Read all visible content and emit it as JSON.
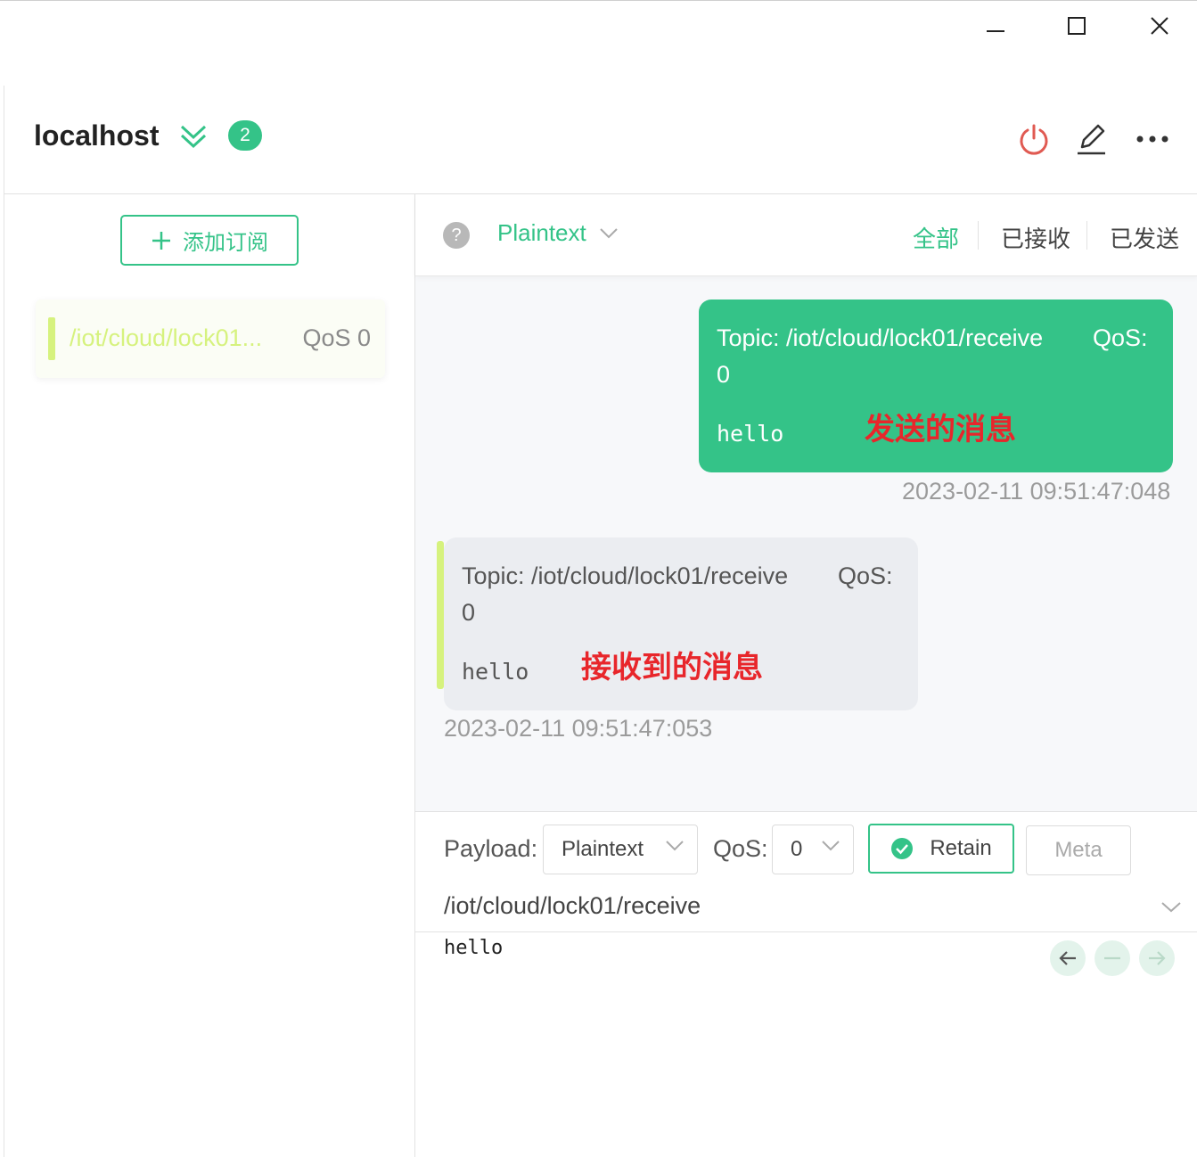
{
  "window": {
    "controls": [
      "minimize-icon",
      "maximize-icon",
      "close-icon"
    ]
  },
  "header": {
    "connection_name": "localhost",
    "badge_count": "2",
    "actions": [
      "power-icon",
      "edit-icon",
      "more-icon"
    ],
    "colors": {
      "accent": "#34c388",
      "disconnect": "#e05a52"
    }
  },
  "sidebar": {
    "add_subscription": "添加订阅",
    "subscriptions": [
      {
        "topic": "/iot/cloud/lock01...",
        "qos": "QoS 0",
        "color": "#d6f27e"
      }
    ]
  },
  "message_toolbar": {
    "format": "Plaintext",
    "filters": {
      "all": "全部",
      "received": "已接收",
      "sent": "已发送"
    },
    "active_filter": "all"
  },
  "messages": [
    {
      "direction": "sent",
      "topic_line1": "Topic: /iot/cloud/lock01/receive",
      "qos_label": "QoS:",
      "qos_value": "0",
      "payload": "hello",
      "annotation": "发送的消息",
      "time": "2023-02-11 09:51:47:048"
    },
    {
      "direction": "received",
      "topic_line1": "Topic: /iot/cloud/lock01/receive",
      "qos_label": "QoS:",
      "qos_value": "0",
      "payload": "hello",
      "annotation": "接收到的消息",
      "time": "2023-02-11 09:51:47:053"
    }
  ],
  "composer": {
    "payload_label": "Payload:",
    "payload_format": "Plaintext",
    "qos_label": "QoS:",
    "qos_value": "0",
    "retain_label": "Retain",
    "retain_checked": true,
    "meta_label": "Meta",
    "topic": "/iot/cloud/lock01/receive",
    "payload": "hello"
  }
}
